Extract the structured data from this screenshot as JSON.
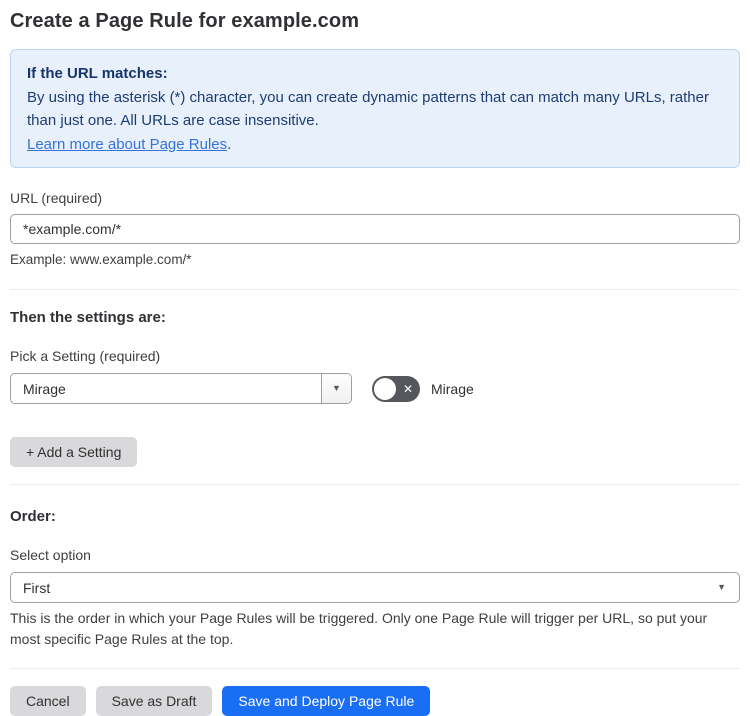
{
  "page": {
    "title": "Create a Page Rule for example.com"
  },
  "info_box": {
    "heading": "If the URL matches:",
    "body": "By using the asterisk (*) character, you can create dynamic patterns that can match many URLs, rather than just one. All URLs are case insensitive.",
    "link_label": "Learn more about Page Rules",
    "link_suffix": "."
  },
  "url_field": {
    "label": "URL (required)",
    "value": "*example.com/*",
    "helper": "Example: www.example.com/*"
  },
  "settings_section": {
    "heading": "Then the settings are:",
    "setting_label": "Pick a Setting (required)",
    "setting_value": "Mirage",
    "toggle_state": "off",
    "toggle_icon": "✕",
    "toggle_label": "Mirage",
    "add_setting_label": "+ Add a Setting",
    "dropdown_arrow": "▼"
  },
  "order_section": {
    "heading": "Order:",
    "label": "Select option",
    "value": "First",
    "dropdown_arrow": "▼",
    "helper": "This is the order in which your Page Rules will be triggered. Only one Page Rule will trigger per URL, so put your most specific Page Rules at the top."
  },
  "footer": {
    "cancel_label": "Cancel",
    "save_draft_label": "Save as Draft",
    "save_deploy_label": "Save and Deploy Page Rule"
  },
  "colors": {
    "accent_blue": "#1a6ef5",
    "info_bg": "#e8f1fb",
    "info_border": "#b8d4f1",
    "info_text": "#1e3c72",
    "link_blue": "#3672d9",
    "toggle_off_bg": "#55575c",
    "button_gray": "#d9d9dc"
  }
}
